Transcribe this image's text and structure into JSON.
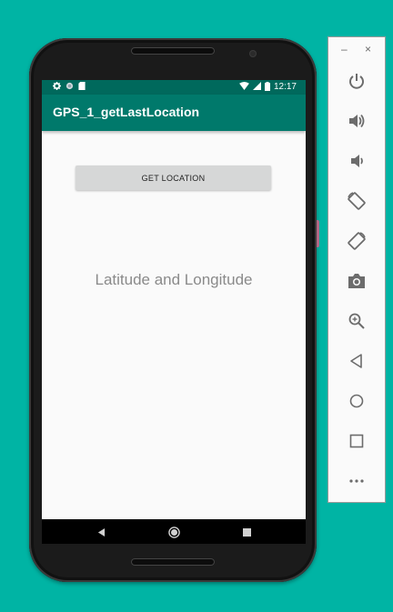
{
  "app": {
    "title": "GPS_1_getLastLocation",
    "button_label": "GET LOCATION",
    "result_text": "Latitude and Longitude"
  },
  "status_bar": {
    "time": "12:17",
    "left_icons": [
      "gear-icon",
      "circle-icon",
      "sd-card-icon"
    ],
    "right_icons": [
      "wifi-icon",
      "signal-icon",
      "battery-icon"
    ]
  },
  "nav_bar": {
    "buttons": [
      "back-icon",
      "home-icon",
      "recents-icon"
    ]
  },
  "emulator_panel": {
    "window_controls": {
      "minimize": "–",
      "close": "×"
    },
    "tools": [
      "power-icon",
      "volume-up-icon",
      "volume-down-icon",
      "rotate-left-icon",
      "rotate-right-icon",
      "camera-icon",
      "zoom-icon",
      "back-icon",
      "home-icon",
      "overview-icon",
      "more-icon"
    ]
  },
  "colors": {
    "background": "#00b4a4",
    "status_bar": "#00695c",
    "app_bar": "#00796b",
    "button": "#d6d7d7",
    "content": "#fafafa"
  }
}
